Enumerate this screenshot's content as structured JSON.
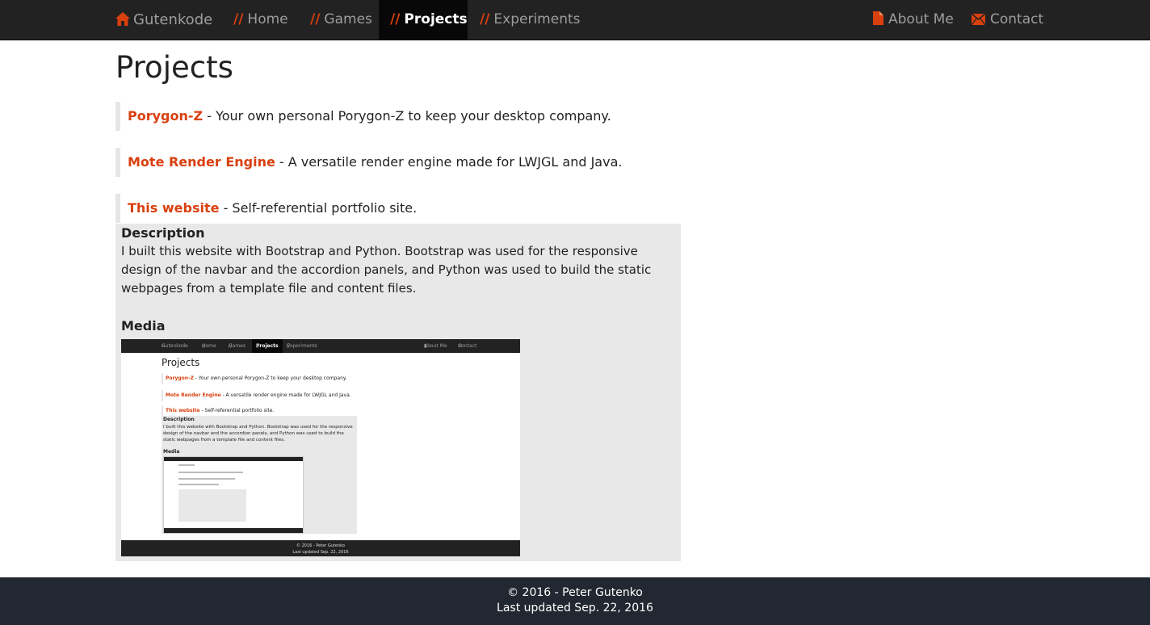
{
  "nav": {
    "brand": "Gutenkode",
    "slash": "//",
    "items": [
      {
        "label": "Home"
      },
      {
        "label": "Games"
      },
      {
        "label": "Projects"
      },
      {
        "label": "Experiments"
      }
    ],
    "right": [
      {
        "label": "About Me",
        "icon": "document-icon"
      },
      {
        "label": "Contact",
        "icon": "envelope-icon"
      }
    ],
    "active": "Projects"
  },
  "page": {
    "title": "Projects"
  },
  "projects": [
    {
      "name": "Porygon-Z",
      "desc": " - Your own personal Porygon-Z to keep your desktop company."
    },
    {
      "name": "Mote Render Engine",
      "desc": " - A versatile render engine made for LWJGL and Java."
    },
    {
      "name": "This website",
      "desc": " - Self-referential portfolio site."
    }
  ],
  "panel": {
    "description_heading": "Description",
    "description_text": "I built this website with Bootstrap and Python. Bootstrap was used for the responsive design of the navbar and the accordion panels, and Python was used to build the static webpages from a template file and content files.",
    "media_heading": "Media"
  },
  "footer": {
    "line1": "© 2016 - Peter Gutenko",
    "line2": "Last updated Sep. 22, 2016"
  },
  "colors": {
    "accent": "#d9400f",
    "navbar": "#222222",
    "footer": "#222831",
    "panel": "#e8e8e8"
  }
}
